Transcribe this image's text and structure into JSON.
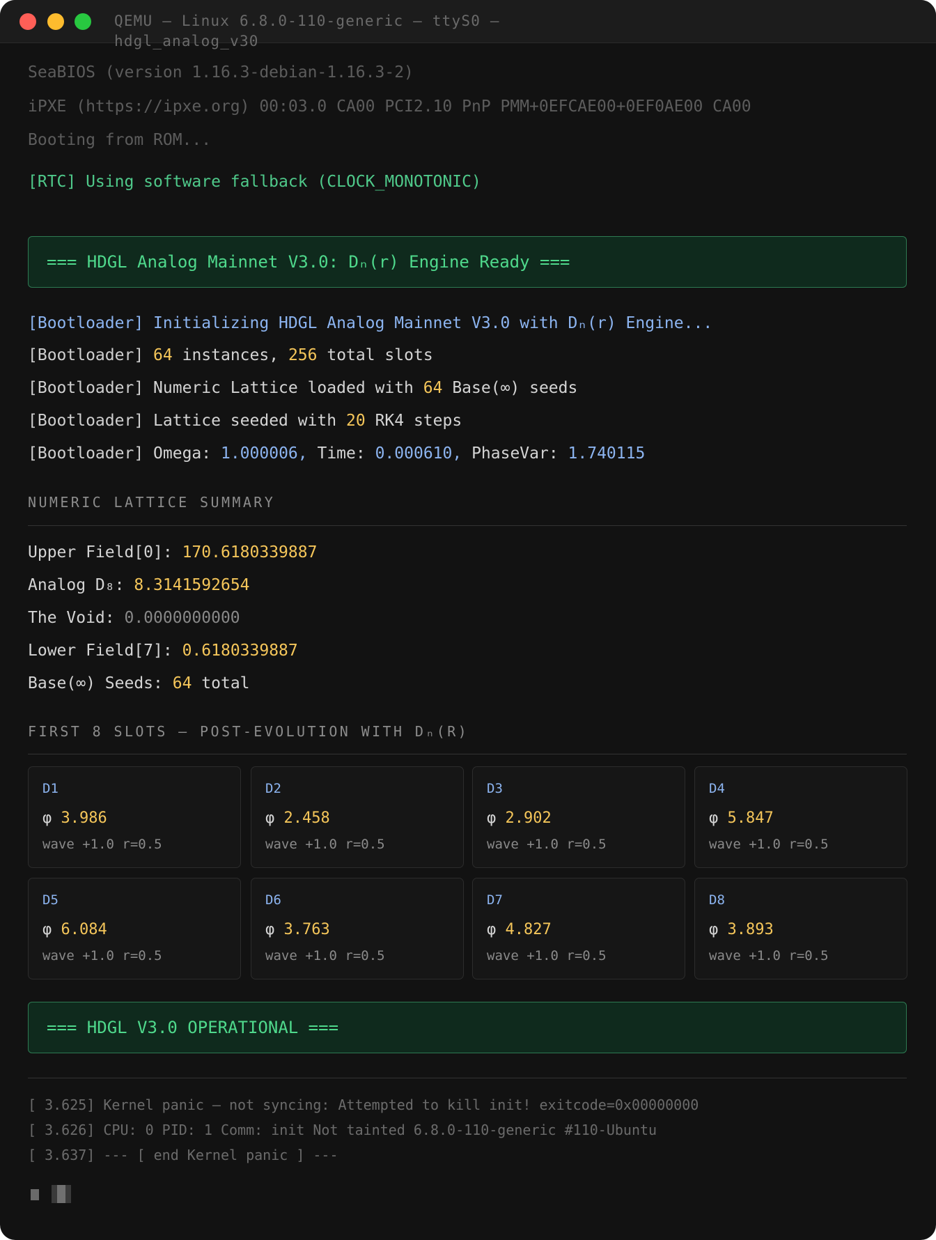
{
  "window": {
    "title": "QEMU — Linux 6.8.0-110-generic — ttyS0 — hdgl_analog_v30",
    "buttons": [
      {
        "name": "close",
        "color": "#ff5f57"
      },
      {
        "name": "minimize",
        "color": "#febc2e"
      },
      {
        "name": "zoom",
        "color": "#28c840"
      }
    ]
  },
  "bios": {
    "line1": "SeaBIOS (version 1.16.3-debian-1.16.3-2)",
    "line2": "iPXE (https://ipxe.org) 00:03.0 CA00 PCI2.10 PnP PMM+0EFCAE00+0EF0AE00 CA00",
    "line3": "Booting from ROM..."
  },
  "rtc_line": "[RTC] Using software fallback (CLOCK_MONOTONIC)",
  "banner_ready": "=== HDGL Analog Mainnet V3.0: Dₙ(r) Engine Ready ===",
  "bootloader": {
    "prefix": "[Bootloader]",
    "init": "Initializing HDGL Analog Mainnet V3.0 with Dₙ(r) Engine...",
    "instances_count": "64",
    "instances_text": "instances,",
    "slots_count": "256",
    "slots_text": "total slots",
    "lattice_text": "Numeric Lattice loaded with",
    "lattice_count": "64",
    "lattice_suffix": "Base(∞) seeds",
    "seeded_text": "Lattice seeded with",
    "seeded_count": "20",
    "seeded_suffix": "RK4 steps",
    "omega_label": "Omega:",
    "omega_value": "1.000006,",
    "time_label": "Time:",
    "time_value": "0.000610,",
    "phasevar_label": "PhaseVar:",
    "phasevar_value": "1.740115"
  },
  "summary": {
    "title": "NUMERIC LATTICE SUMMARY",
    "upper_label": "Upper Field[0]:",
    "upper_value": "170.6180339887",
    "analog_label": "Analog D₈:",
    "analog_value": "8.3141592654",
    "void_label": "The Void:",
    "void_value": "0.0000000000",
    "lower_label": "Lower Field[7]:",
    "lower_value": "0.6180339887",
    "seeds_label": "Base(∞) Seeds:",
    "seeds_value": "64",
    "seeds_suffix": "total"
  },
  "slots": {
    "title": "FIRST 8 SLOTS — POST-EVOLUTION WITH Dₙ(R)",
    "phi_symbol": "φ",
    "items": [
      {
        "label": "D1",
        "phi": "3.986",
        "wave": "wave +1.0 r=0.5"
      },
      {
        "label": "D2",
        "phi": "2.458",
        "wave": "wave +1.0 r=0.5"
      },
      {
        "label": "D3",
        "phi": "2.902",
        "wave": "wave +1.0 r=0.5"
      },
      {
        "label": "D4",
        "phi": "5.847",
        "wave": "wave +1.0 r=0.5"
      },
      {
        "label": "D5",
        "phi": "6.084",
        "wave": "wave +1.0 r=0.5"
      },
      {
        "label": "D6",
        "phi": "3.763",
        "wave": "wave +1.0 r=0.5"
      },
      {
        "label": "D7",
        "phi": "4.827",
        "wave": "wave +1.0 r=0.5"
      },
      {
        "label": "D8",
        "phi": "3.893",
        "wave": "wave +1.0 r=0.5"
      }
    ]
  },
  "banner_operational": "=== HDGL V3.0 OPERATIONAL ===",
  "panic": {
    "line1": "[ 3.625] Kernel panic — not syncing: Attempted to kill init! exitcode=0x00000000",
    "line2": "[ 3.626] CPU: 0 PID: 1 Comm: init Not tainted 6.8.0-110-generic #110-Ubuntu",
    "line3": "[ 3.637] --- [ end Kernel panic ] ---"
  }
}
